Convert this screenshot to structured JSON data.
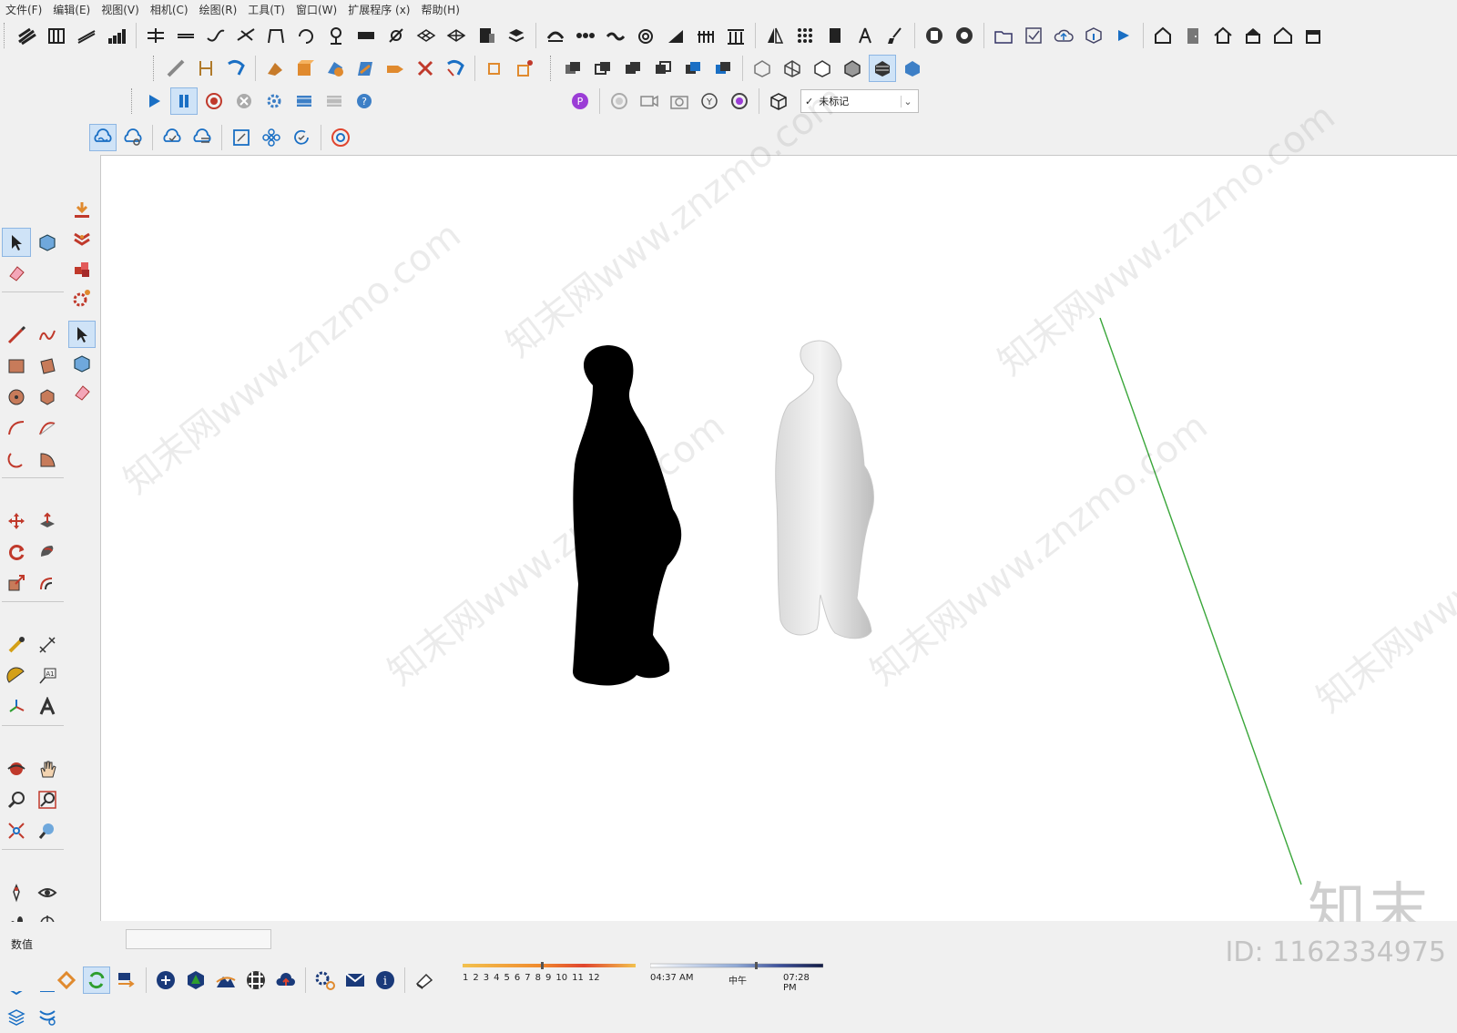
{
  "menubar": {
    "items": [
      "文件(F)",
      "编辑(E)",
      "视图(V)",
      "相机(C)",
      "绘图(R)",
      "工具(T)",
      "窗口(W)",
      "扩展程序 (x)",
      "帮助(H)"
    ]
  },
  "tag_dropdown": {
    "value": "未标记"
  },
  "statusbar": {
    "vcb_label": "数值",
    "vcb_value": "",
    "month_ticks": [
      "1",
      "2",
      "3",
      "4",
      "5",
      "6",
      "7",
      "8",
      "9",
      "10",
      "11",
      "12"
    ],
    "time_start": "04:37 AM",
    "time_mid": "中午",
    "time_end": "07:28 PM"
  },
  "watermark": {
    "text": "知末网www.znzmo.com",
    "brand": "知末",
    "id": "ID: 1162334975"
  },
  "colors": {
    "toolbar_bg": "#f0f0f0",
    "viewport_bg": "#ffffff",
    "green_axis": "#3aa63a",
    "active_button": "#cfe3f7",
    "black_figure": "#000000",
    "white_figure": "#e2e2e2"
  }
}
